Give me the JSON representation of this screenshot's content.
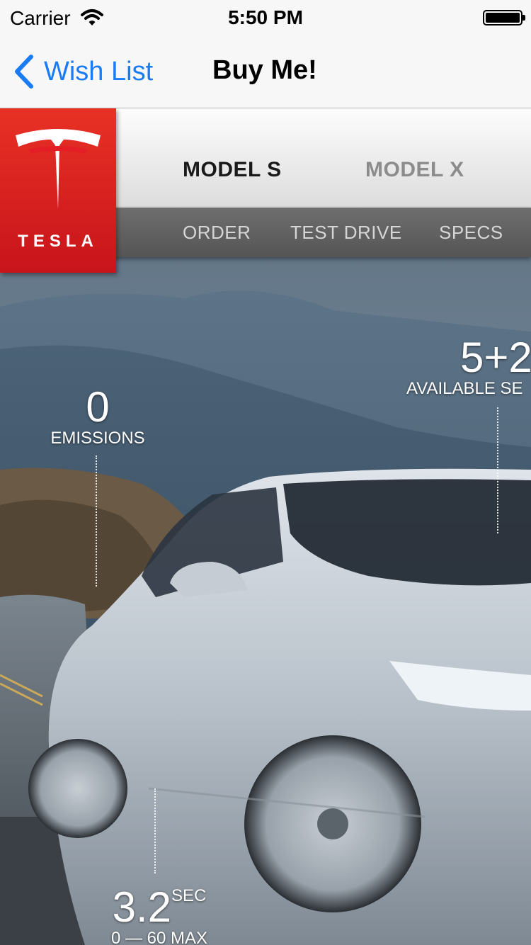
{
  "status_bar": {
    "carrier": "Carrier",
    "time": "5:50 PM"
  },
  "nav": {
    "back_label": "Wish List",
    "title": "Buy Me!"
  },
  "tesla": {
    "wordmark": "TESLA",
    "tabs": [
      "MODEL S",
      "MODEL X"
    ],
    "sub_tabs": [
      "ORDER",
      "TEST DRIVE",
      "SPECS"
    ],
    "stats": {
      "emissions": {
        "value": "0",
        "label": "EMISSIONS"
      },
      "seats": {
        "value": "5+2",
        "label": "AVAILABLE SE"
      },
      "acceleration": {
        "value": "3.2",
        "unit": "SEC",
        "label": "0 — 60 MAX"
      }
    }
  },
  "colors": {
    "ios_blue": "#1a7cf5",
    "tesla_red": "#e31e24"
  }
}
